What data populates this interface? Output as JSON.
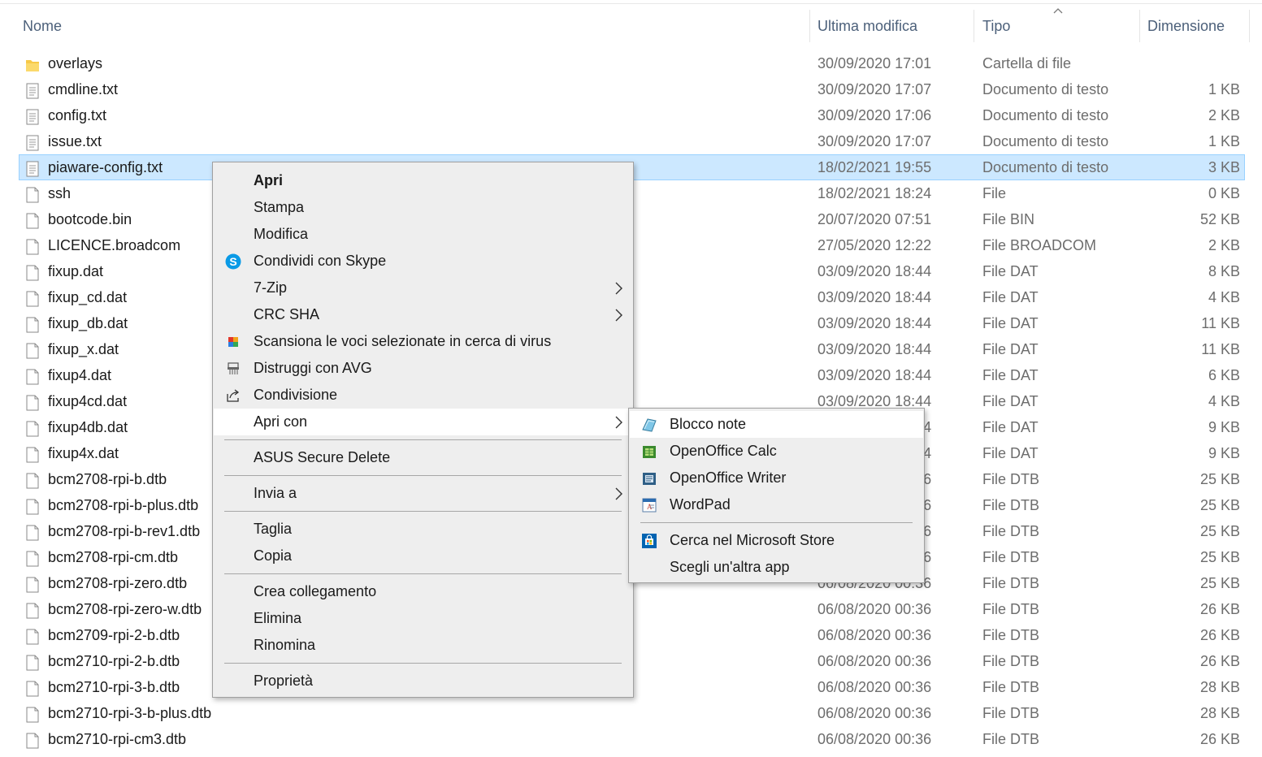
{
  "columns": {
    "name": "Nome",
    "modified": "Ultima modifica",
    "type": "Tipo",
    "size": "Dimensione"
  },
  "files": [
    {
      "name": "overlays",
      "modified": "30/09/2020 17:01",
      "type": "Cartella di file",
      "size": "",
      "icon": "folder-icon"
    },
    {
      "name": "cmdline.txt",
      "modified": "30/09/2020 17:07",
      "type": "Documento di testo",
      "size": "1 KB",
      "icon": "text-file-icon"
    },
    {
      "name": "config.txt",
      "modified": "30/09/2020 17:06",
      "type": "Documento di testo",
      "size": "2 KB",
      "icon": "text-file-icon"
    },
    {
      "name": "issue.txt",
      "modified": "30/09/2020 17:07",
      "type": "Documento di testo",
      "size": "1 KB",
      "icon": "text-file-icon"
    },
    {
      "name": "piaware-config.txt",
      "modified": "18/02/2021 19:55",
      "type": "Documento di testo",
      "size": "3 KB",
      "icon": "text-file-icon",
      "selected": true
    },
    {
      "name": "ssh",
      "modified": "18/02/2021 18:24",
      "type": "File",
      "size": "0 KB",
      "icon": "file-icon"
    },
    {
      "name": "bootcode.bin",
      "modified": "20/07/2020 07:51",
      "type": "File BIN",
      "size": "52 KB",
      "icon": "file-icon"
    },
    {
      "name": "LICENCE.broadcom",
      "modified": "27/05/2020 12:22",
      "type": "File BROADCOM",
      "size": "2 KB",
      "icon": "file-icon"
    },
    {
      "name": "fixup.dat",
      "modified": "03/09/2020 18:44",
      "type": "File DAT",
      "size": "8 KB",
      "icon": "file-icon"
    },
    {
      "name": "fixup_cd.dat",
      "modified": "03/09/2020 18:44",
      "type": "File DAT",
      "size": "4 KB",
      "icon": "file-icon"
    },
    {
      "name": "fixup_db.dat",
      "modified": "03/09/2020 18:44",
      "type": "File DAT",
      "size": "11 KB",
      "icon": "file-icon"
    },
    {
      "name": "fixup_x.dat",
      "modified": "03/09/2020 18:44",
      "type": "File DAT",
      "size": "11 KB",
      "icon": "file-icon"
    },
    {
      "name": "fixup4.dat",
      "modified": "03/09/2020 18:44",
      "type": "File DAT",
      "size": "6 KB",
      "icon": "file-icon"
    },
    {
      "name": "fixup4cd.dat",
      "modified": "03/09/2020 18:44",
      "type": "File DAT",
      "size": "4 KB",
      "icon": "file-icon"
    },
    {
      "name": "fixup4db.dat",
      "modified": "03/09/2020 18:44",
      "type": "File DAT",
      "size": "9 KB",
      "icon": "file-icon"
    },
    {
      "name": "fixup4x.dat",
      "modified": "03/09/2020 18:44",
      "type": "File DAT",
      "size": "9 KB",
      "icon": "file-icon"
    },
    {
      "name": "bcm2708-rpi-b.dtb",
      "modified": "06/08/2020 00:36",
      "type": "File DTB",
      "size": "25 KB",
      "icon": "file-icon"
    },
    {
      "name": "bcm2708-rpi-b-plus.dtb",
      "modified": "06/08/2020 00:36",
      "type": "File DTB",
      "size": "25 KB",
      "icon": "file-icon"
    },
    {
      "name": "bcm2708-rpi-b-rev1.dtb",
      "modified": "06/08/2020 00:36",
      "type": "File DTB",
      "size": "25 KB",
      "icon": "file-icon"
    },
    {
      "name": "bcm2708-rpi-cm.dtb",
      "modified": "06/08/2020 00:36",
      "type": "File DTB",
      "size": "25 KB",
      "icon": "file-icon"
    },
    {
      "name": "bcm2708-rpi-zero.dtb",
      "modified": "06/08/2020 00:36",
      "type": "File DTB",
      "size": "25 KB",
      "icon": "file-icon"
    },
    {
      "name": "bcm2708-rpi-zero-w.dtb",
      "modified": "06/08/2020 00:36",
      "type": "File DTB",
      "size": "26 KB",
      "icon": "file-icon"
    },
    {
      "name": "bcm2709-rpi-2-b.dtb",
      "modified": "06/08/2020 00:36",
      "type": "File DTB",
      "size": "26 KB",
      "icon": "file-icon"
    },
    {
      "name": "bcm2710-rpi-2-b.dtb",
      "modified": "06/08/2020 00:36",
      "type": "File DTB",
      "size": "26 KB",
      "icon": "file-icon"
    },
    {
      "name": "bcm2710-rpi-3-b.dtb",
      "modified": "06/08/2020 00:36",
      "type": "File DTB",
      "size": "28 KB",
      "icon": "file-icon"
    },
    {
      "name": "bcm2710-rpi-3-b-plus.dtb",
      "modified": "06/08/2020 00:36",
      "type": "File DTB",
      "size": "28 KB",
      "icon": "file-icon"
    },
    {
      "name": "bcm2710-rpi-cm3.dtb",
      "modified": "06/08/2020 00:36",
      "type": "File DTB",
      "size": "26 KB",
      "icon": "file-icon"
    }
  ],
  "context_menu": {
    "open": "Apri",
    "print": "Stampa",
    "edit": "Modifica",
    "share_skype": "Condividi con Skype",
    "zip": "7-Zip",
    "crc": "CRC SHA",
    "scan": "Scansiona le voci selezionate in cerca di virus",
    "shred": "Distruggi con AVG",
    "share": "Condivisione",
    "open_with": "Apri con",
    "asus": "ASUS Secure Delete",
    "send_to": "Invia a",
    "cut": "Taglia",
    "copy": "Copia",
    "shortcut": "Crea collegamento",
    "delete": "Elimina",
    "rename": "Rinomina",
    "properties": "Proprietà"
  },
  "open_with_menu": {
    "notepad": "Blocco note",
    "calc": "OpenOffice Calc",
    "writer": "OpenOffice Writer",
    "wordpad": "WordPad",
    "store": "Cerca nel Microsoft Store",
    "choose": "Scegli un'altra app"
  },
  "colors": {
    "selection": "#cce8ff",
    "selection_border": "#99d1ff",
    "header_text": "#4c607a",
    "detail_text": "#6d6d6d",
    "menu_bg": "#eeeeee",
    "skype_blue": "#0a9ae6"
  }
}
